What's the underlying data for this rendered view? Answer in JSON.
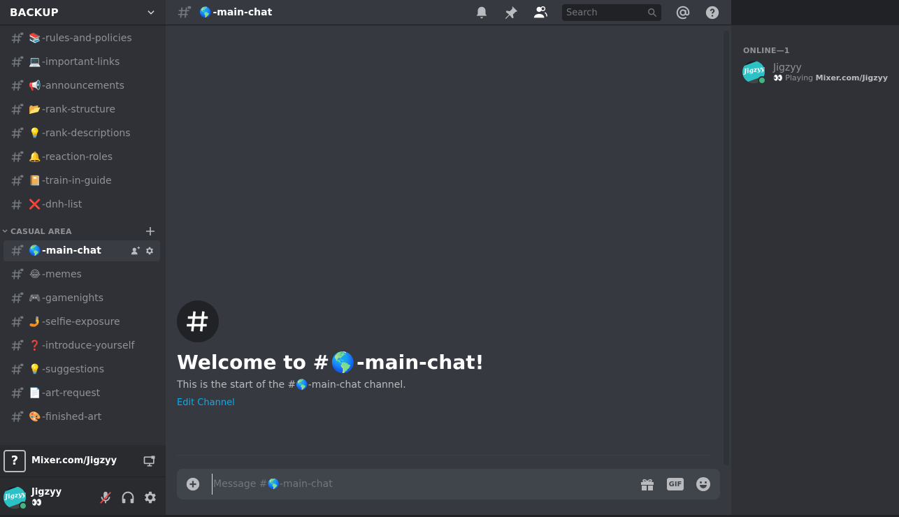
{
  "server": {
    "name": "BACKUP"
  },
  "channels_top": [
    {
      "emoji": "📚",
      "name": "-rules-and-policies",
      "locked": true
    },
    {
      "emoji": "💻",
      "name": "-important-links",
      "locked": true
    },
    {
      "emoji": "📢",
      "name": "-announcements",
      "locked": true
    },
    {
      "emoji": "📂",
      "name": "-rank-structure",
      "locked": true
    },
    {
      "emoji": "💡",
      "name": "-rank-descriptions",
      "locked": true
    },
    {
      "emoji": "🔔",
      "name": "-reaction-roles",
      "locked": true
    },
    {
      "emoji": "📔",
      "name": "-train-in-guide",
      "locked": true
    },
    {
      "emoji": "❌",
      "name": "-dnh-list",
      "locked": false
    }
  ],
  "category": {
    "name": "CASUAL AREA"
  },
  "channels_casual": [
    {
      "emoji": "🌎",
      "name": "-main-chat",
      "active": true
    },
    {
      "emoji": "😂",
      "name": "-memes"
    },
    {
      "emoji": "🎮",
      "name": "-gamenights"
    },
    {
      "emoji": "🤳",
      "name": "-selfie-exposure"
    },
    {
      "emoji": "❓",
      "name": "-introduce-yourself"
    },
    {
      "emoji": "💡",
      "name": "-suggestions"
    },
    {
      "emoji": "📄",
      "name": "-art-request"
    },
    {
      "emoji": "🎨",
      "name": "-finished-art"
    }
  ],
  "activity": {
    "game": "Mixer.com/Jigzyy",
    "icon": "?"
  },
  "user": {
    "name": "Jigzyy",
    "avatar_text": "Jigzyy",
    "status_emoji": "👀",
    "status_color": "#43b581"
  },
  "header": {
    "channel_emoji": "🌎",
    "channel_name": "-main-chat",
    "search_placeholder": "Search"
  },
  "welcome": {
    "title_prefix": "Welcome to #",
    "globe": "🌎",
    "title_suffix": "-main-chat!",
    "subtitle_prefix": "This is the start of the #",
    "subtitle_suffix": "-main-chat channel.",
    "edit_link": "Edit Channel"
  },
  "composer": {
    "placeholder": "Message #🌎-main-chat",
    "gif_label": "GIF"
  },
  "members": {
    "header": "ONLINE—1",
    "list": [
      {
        "name": "Jigzyy",
        "activity_emoji": "👀",
        "activity_prefix": "Playing ",
        "activity_name": "Mixer.com/Jigzyy"
      }
    ]
  },
  "colors": {
    "accent_link": "#00b0f4",
    "online": "#43b581"
  }
}
